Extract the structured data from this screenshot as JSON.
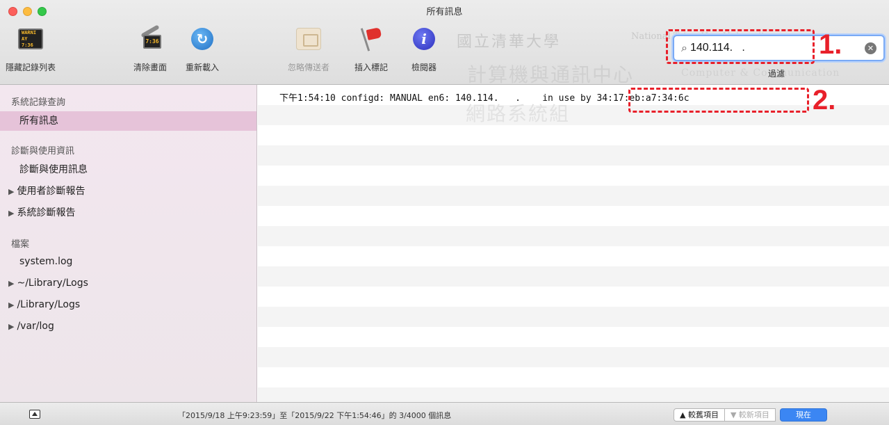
{
  "window": {
    "title": "所有訊息"
  },
  "toolbar": {
    "hide_list": {
      "label": "隱藏記錄列表",
      "icon": "console-icon",
      "screen_lines": [
        "WARNI",
        "AY 7:36"
      ]
    },
    "clear": {
      "label": "清除畫面",
      "icon": "clear-display-icon",
      "screen_text": "7:36"
    },
    "reload": {
      "label": "重新載入",
      "icon": "reload-icon",
      "glyph": "↻"
    },
    "ignore_sender": {
      "label": "忽略傳送者",
      "icon": "ignore-sender-icon"
    },
    "insert_marker": {
      "label": "插入標記",
      "icon": "flag-icon"
    },
    "inspector": {
      "label": "檢閱器",
      "icon": "info-icon",
      "glyph": "i"
    }
  },
  "watermark": {
    "school_cn": "國立清華大學",
    "school_en": "National Tsing Hua University",
    "center_cn": "計算機與通訊中心",
    "center_en": "Computer & Communication",
    "group_cn": "網路系統組"
  },
  "search": {
    "value": "140.114.   .",
    "clear_glyph": "✕",
    "filter_label": "過濾"
  },
  "annotations": {
    "one": "1.",
    "two": "2."
  },
  "sidebar": {
    "sections": [
      {
        "header": "系統記錄查詢",
        "items": [
          {
            "label": "所有訊息",
            "selected": true
          }
        ]
      },
      {
        "header": "診斷與使用資訊",
        "items": [
          {
            "label": "診斷與使用訊息"
          },
          {
            "label": "使用者診斷報告",
            "disclosure": "▶"
          },
          {
            "label": "系統診斷報告",
            "disclosure": "▶"
          }
        ]
      },
      {
        "header": "檔案",
        "items": [
          {
            "label": "system.log"
          },
          {
            "label": "~/Library/Logs",
            "disclosure": "▶"
          },
          {
            "label": "/Library/Logs",
            "disclosure": "▶"
          },
          {
            "label": "/var/log",
            "disclosure": "▶"
          }
        ]
      }
    ]
  },
  "log": {
    "entries": [
      "下午1:54:10 configd: MANUAL en6: 140.114.   .    in use by 34:17:eb:a7:34:6c"
    ]
  },
  "status": {
    "range_text": "「2015/9/18 上午9:23:59」至「2015/9/22 下午1:54:46」的 3/4000 個訊息",
    "older_label": "▲ 較舊項目",
    "newer_label": "▼ 較新項目",
    "now_label": "現在"
  },
  "colors": {
    "accent": "#3b86f3",
    "selection": "#e6c3d9",
    "annotation": "#e8202a"
  }
}
